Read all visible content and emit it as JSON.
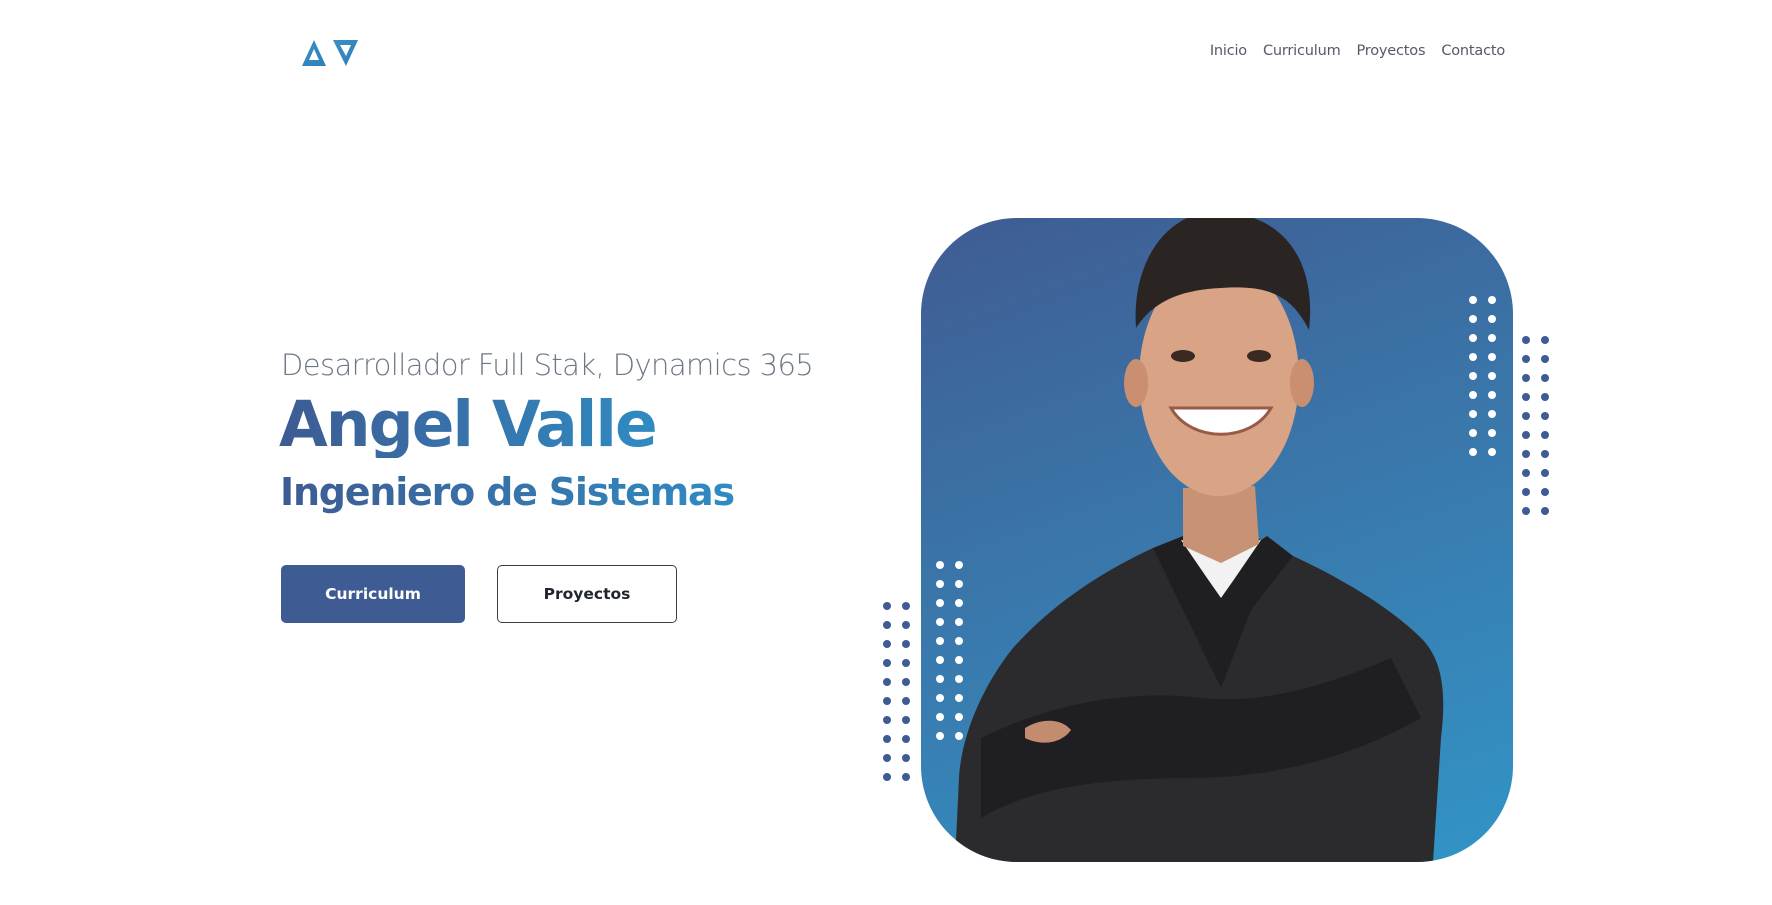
{
  "header": {
    "logo_text": "AV",
    "nav": [
      "Inicio",
      "Curriculum",
      "Proyectos",
      "Contacto"
    ]
  },
  "hero": {
    "subtitle": "Desarrollador Full Stak, Dynamics 365",
    "name": "Angel Valle",
    "role": "Ingeniero de Sistemas",
    "primary_button": "Curriculum",
    "secondary_button": "Proyectos"
  },
  "colors": {
    "primary": "#3e5b93",
    "accent": "#2f8bc2",
    "muted_text": "#6e7785"
  },
  "icons": [
    "av-logo-icon",
    "portrait-photo",
    "dot-pattern"
  ]
}
